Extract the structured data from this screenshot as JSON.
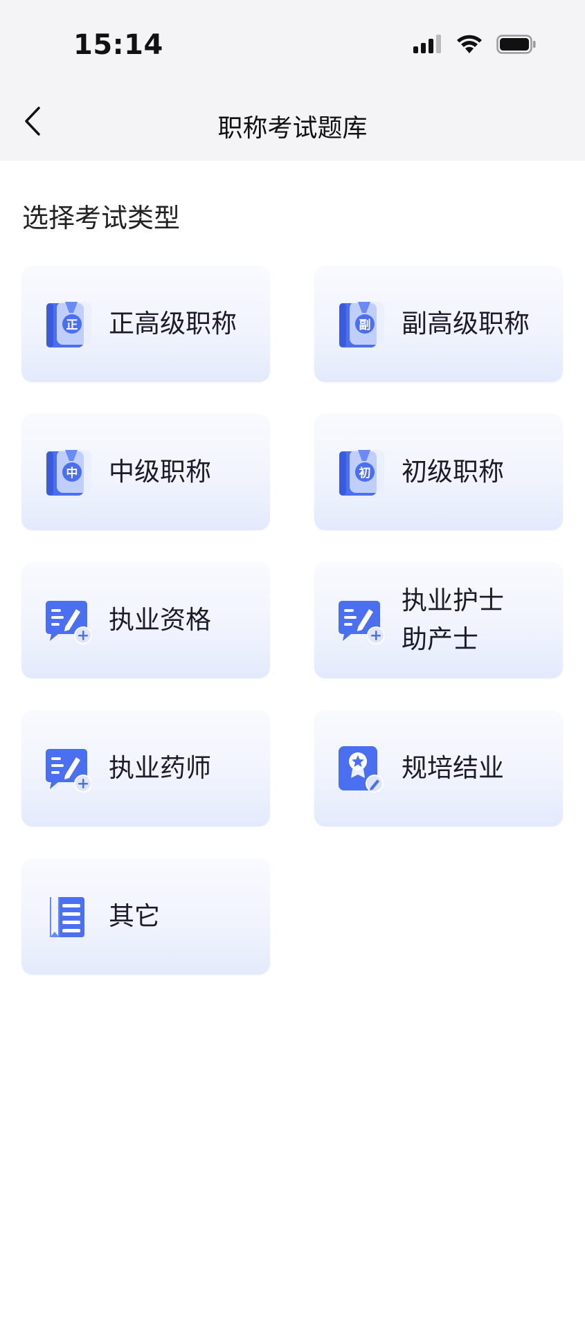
{
  "status_bar": {
    "time": "15:14",
    "icons": [
      "cellular-signal-icon",
      "wifi-icon",
      "battery-icon"
    ]
  },
  "nav": {
    "back_icon": "chevron-left-icon",
    "title": "职称考试题库"
  },
  "section_title": "选择考试类型",
  "colors": {
    "accent": "#4a6ff0",
    "card_top": "#f9fafe",
    "card_bottom": "#e3eafc",
    "header_bg": "#f4f4f6"
  },
  "categories": [
    {
      "label_lines": [
        "正高级职称"
      ],
      "icon": "medal-book-icon",
      "badge": "正"
    },
    {
      "label_lines": [
        "副高级职称"
      ],
      "icon": "medal-book-icon",
      "badge": "副"
    },
    {
      "label_lines": [
        "中级职称"
      ],
      "icon": "medal-book-icon",
      "badge": "中"
    },
    {
      "label_lines": [
        "初级职称"
      ],
      "icon": "medal-book-icon",
      "badge": "初"
    },
    {
      "label_lines": [
        "执业资格"
      ],
      "icon": "edit-document-plus-icon"
    },
    {
      "label_lines": [
        "执业护士",
        "助产士"
      ],
      "icon": "edit-document-plus-icon"
    },
    {
      "label_lines": [
        "执业药师"
      ],
      "icon": "edit-document-plus-icon"
    },
    {
      "label_lines": [
        "规培结业"
      ],
      "icon": "certificate-star-icon"
    },
    {
      "label_lines": [
        "其它"
      ],
      "icon": "bookmark-list-icon"
    }
  ]
}
